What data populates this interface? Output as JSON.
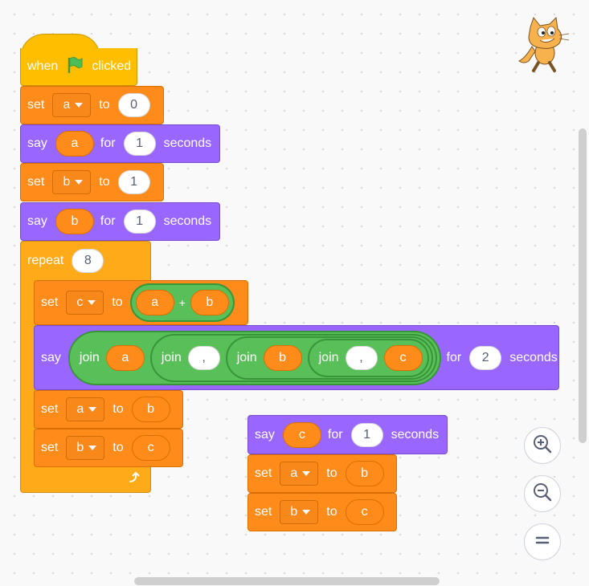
{
  "script1": {
    "hat": {
      "when": "when",
      "clicked": "clicked",
      "icon": "green-flag-icon"
    },
    "set_a": {
      "set": "set",
      "var": "a",
      "to": "to",
      "value": "0"
    },
    "say_a": {
      "say": "say",
      "var": "a",
      "for": "for",
      "secs": "1",
      "seconds": "seconds"
    },
    "set_b": {
      "set": "set",
      "var": "b",
      "to": "to",
      "value": "1"
    },
    "say_b": {
      "say": "say",
      "var": "b",
      "for": "for",
      "secs": "1",
      "seconds": "seconds"
    },
    "repeat": {
      "label": "repeat",
      "count": "8"
    },
    "set_c": {
      "set": "set",
      "var": "c",
      "to": "to",
      "left": "a",
      "plus": "+",
      "right": "b"
    },
    "say_join": {
      "say": "say",
      "join": "join",
      "a": "a",
      "comma1": ",",
      "b": "b",
      "comma2": ",",
      "c": "c",
      "for": "for",
      "secs": "2",
      "seconds": "seconds"
    },
    "set_a2": {
      "set": "set",
      "var": "a",
      "to": "to",
      "value": "b"
    },
    "set_b2": {
      "set": "set",
      "var": "b",
      "to": "to",
      "value": "c"
    }
  },
  "script2": {
    "say_c": {
      "say": "say",
      "var": "c",
      "for": "for",
      "secs": "1",
      "seconds": "seconds"
    },
    "set_a": {
      "set": "set",
      "var": "a",
      "to": "to",
      "value": "b"
    },
    "set_b": {
      "set": "set",
      "var": "b",
      "to": "to",
      "value": "c"
    }
  },
  "icons": {
    "sprite": "scratch-cat-icon",
    "zoom_in": "zoom-in-icon",
    "zoom_out": "zoom-out-icon",
    "reset": "zoom-reset-icon",
    "loop": "loop-arrow-icon"
  },
  "colors": {
    "events": "#ffbf00",
    "variables": "#ff8c1a",
    "looks": "#9966ff",
    "control": "#ffab19",
    "operators": "#59c059"
  }
}
